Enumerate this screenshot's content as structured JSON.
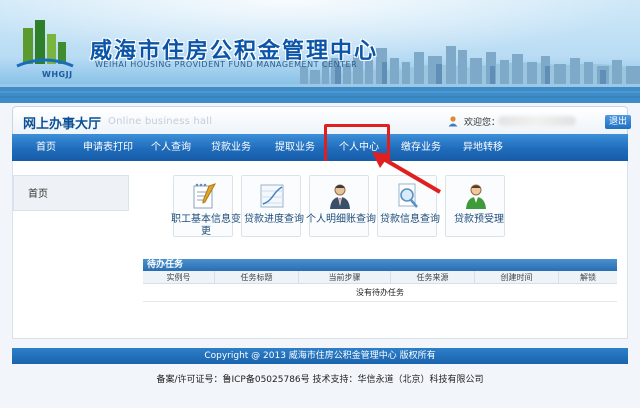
{
  "banner": {
    "title": "威海市住房公积金管理中心",
    "subtitle": "WEIHAI HOUSING PROVIDENT FUND MANAGEMENT CENTER",
    "logo_text": "WHGJJ"
  },
  "hall": {
    "title": "网上办事大厅",
    "subtitle_en": "Online business hall",
    "welcome": "欢迎您：",
    "logout": "退出"
  },
  "nav": {
    "items": [
      {
        "label": "首页"
      },
      {
        "label": "申请表打印"
      },
      {
        "label": "个人查询"
      },
      {
        "label": "贷款业务"
      },
      {
        "label": "提取业务"
      },
      {
        "label": "个人中心"
      },
      {
        "label": "缴存业务"
      },
      {
        "label": "异地转移"
      }
    ],
    "highlighted": "个人中心"
  },
  "sidebar": {
    "items": [
      {
        "label": "首页"
      }
    ]
  },
  "tiles": [
    {
      "label_line1": "职工基本信息变",
      "label_line2": "更",
      "icon": "notepad-icon"
    },
    {
      "label_line1": "贷款进度查询",
      "label_line2": "",
      "icon": "line-chart-icon"
    },
    {
      "label_line1": "个人明细账查询",
      "label_line2": "",
      "icon": "person-tie-icon"
    },
    {
      "label_line1": "贷款信息查询",
      "label_line2": "",
      "icon": "search-doc-icon"
    },
    {
      "label_line1": "贷款预受理",
      "label_line2": "",
      "icon": "person-green-icon"
    }
  ],
  "tasks": {
    "title": "待办任务",
    "columns": [
      "实例号",
      "任务标题",
      "当前步骤",
      "任务来源",
      "创建时间",
      "解锁"
    ],
    "empty_text": "没有待办任务"
  },
  "footer": {
    "copyright": "Copyright @ 2013 威海市住房公积金管理中心 版权所有",
    "icp": "备案/许可证号：鲁ICP备05025786号 技术支持：华信永道（北京）科技有限公司"
  },
  "colors": {
    "nav_blue": "#1f6cbc",
    "highlight_red": "#e02020",
    "title_blue": "#0b55a8"
  }
}
